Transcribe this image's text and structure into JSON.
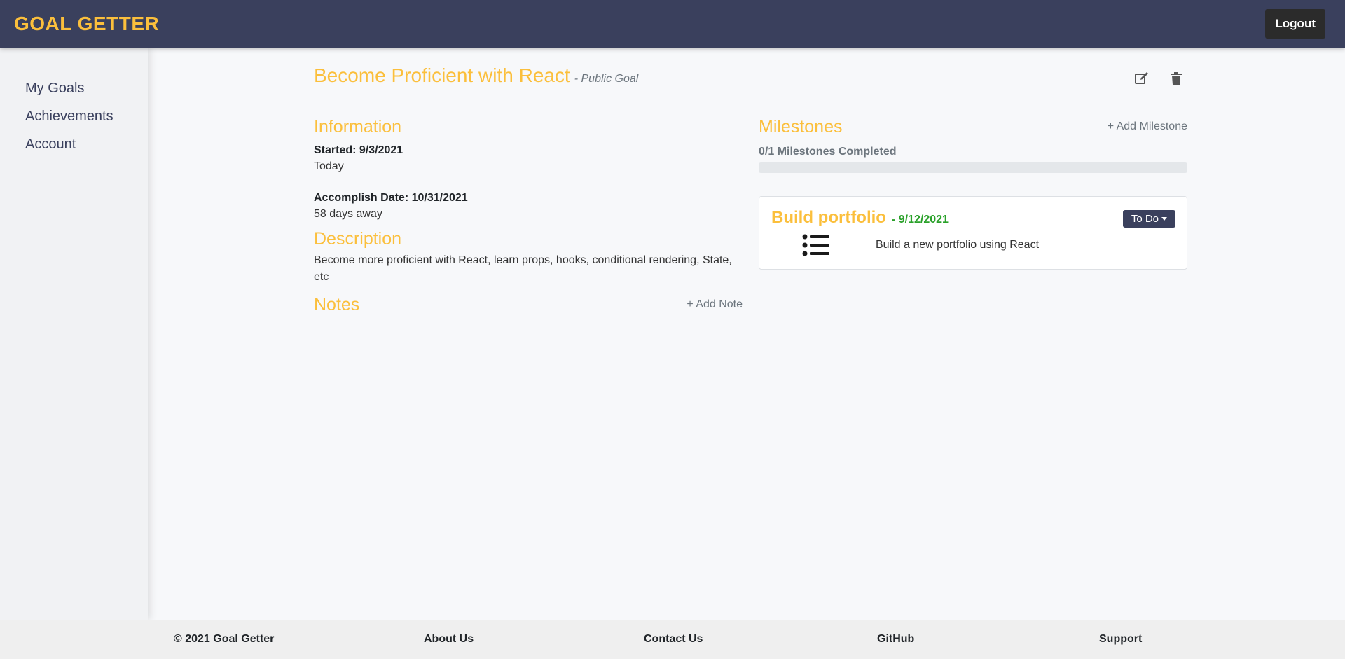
{
  "app": {
    "brand": "GOAL GETTER",
    "logout_label": "Logout"
  },
  "sidebar": {
    "items": [
      {
        "label": "My Goals"
      },
      {
        "label": "Achievements"
      },
      {
        "label": "Account"
      }
    ]
  },
  "goal": {
    "title": "Become Proficient with React",
    "visibility": "- Public Goal",
    "icons": {
      "edit": "edit-icon",
      "delete": "trash-icon"
    },
    "information_title": "Information",
    "started_label": "Started: 9/3/2021",
    "started_relative": "Today",
    "accomplish_label": "Accomplish Date: 10/31/2021",
    "accomplish_relative": "58 days away",
    "description_title": "Description",
    "description": "Become more proficient with React, learn props, hooks, conditional rendering, State, etc",
    "notes_title": "Notes",
    "add_note_label": "+ Add Note"
  },
  "milestones": {
    "title": "Milestones",
    "add_label": "+ Add Milestone",
    "completed_text": "0/1 Milestones Completed",
    "progress_fraction": 0,
    "items": [
      {
        "title": "Build portfolio",
        "date": "- 9/12/2021",
        "status": "To Do",
        "description": "Build a new portfolio using React",
        "icon": "list-icon"
      }
    ]
  },
  "footer": {
    "items": [
      "© 2021 Goal Getter",
      "About Us",
      "Contact Us",
      "GitHub",
      "Support"
    ]
  },
  "colors": {
    "accent": "#fbbf3c",
    "navy": "#3a405d",
    "success": "#2aa12a"
  }
}
